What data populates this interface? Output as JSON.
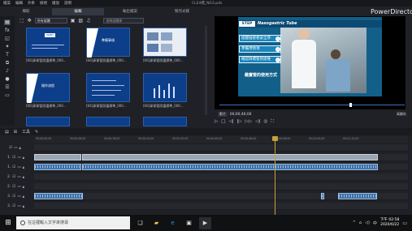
{
  "window": {
    "filename": "CLE4標_NG3.pds",
    "brand": "PowerDirector",
    "menu": [
      "檔案",
      "編輯",
      "外掛",
      "檢視",
      "播放",
      "說明"
    ]
  },
  "tabs": [
    "擷取",
    "編輯",
    "輸出檔案",
    "製作光碟"
  ],
  "library": {
    "dropdown": "所有媒體",
    "search_placeholder": "搜尋媒體庫",
    "thumbs": [
      {
        "title": "NABH",
        "caption": "[66]鼻胃管照護標準_000..."
      },
      {
        "title": "準備事項",
        "caption": "[66]鼻胃管照護標準_000..."
      },
      {
        "title": "",
        "caption": "[66]鼻胃管照護標準_000..."
      },
      {
        "title": "操作流程",
        "caption": "[66]鼻胃管照護標準_000..."
      },
      {
        "title": "",
        "caption": "[66]鼻胃管照護標準_000..."
      },
      {
        "title": "",
        "caption": "[66]鼻胃管照護標準_000..."
      }
    ]
  },
  "preview": {
    "step": "STEP",
    "title": "Nasogastric Tube",
    "items": [
      "提醒插管者安全序",
      "準備用物項",
      "確認目標管到達堆"
    ],
    "howto": "義實管的使用方式"
  },
  "player": {
    "type_label": "影片",
    "timecode": "00;00;46;00",
    "quality": "高解析"
  },
  "timeline": {
    "tool_label": "工具",
    "ruler": [
      "00;00;00;00",
      "00;00;08;00",
      "00;00;16;00",
      "00;00;24;00",
      "00;00;32;00",
      "00;00;40;00",
      "00;00;48;00",
      "00;00;56;00",
      "00;01;04;00",
      "00;01;12;00"
    ],
    "tracks": [
      "1.",
      "1.",
      "2.",
      "2.",
      "3.",
      "3."
    ]
  },
  "taskbar": {
    "search_placeholder": "在這裡輸入文字來搜尋",
    "time": "下午 02:58",
    "date": "2020/6/22",
    "lang": "中"
  },
  "colors": {
    "accent": "#126089",
    "playhead": "#c7a13d",
    "clip": "#3a5b86"
  }
}
